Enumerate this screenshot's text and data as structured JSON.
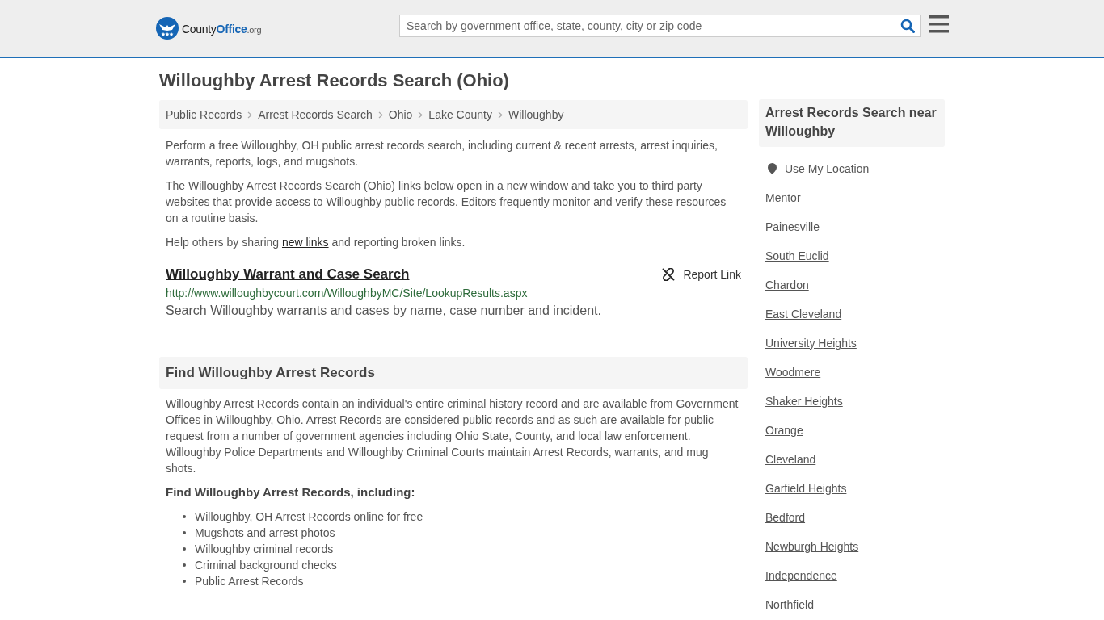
{
  "header": {
    "logo": {
      "parts": [
        "County",
        "Office",
        ".org"
      ]
    },
    "search": {
      "placeholder": "Search by government office, state, county, city or zip code"
    }
  },
  "page_title": "Willoughby Arrest Records Search (Ohio)",
  "breadcrumb": [
    "Public Records",
    "Arrest Records Search",
    "Ohio",
    "Lake County",
    "Willoughby"
  ],
  "intro": [
    "Perform a free Willoughby, OH public arrest records search, including current & recent arrests, arrest inquiries, warrants, reports, logs, and mugshots.",
    "The Willoughby Arrest Records Search (Ohio) links below open in a new window and take you to third party websites that provide access to Willoughby public records. Editors frequently monitor and verify these resources on a routine basis."
  ],
  "help": {
    "before": "Help others by sharing ",
    "link": "new links",
    "after": " and reporting broken links."
  },
  "links": [
    {
      "title": "Willoughby Warrant and Case Search",
      "report": "Report Link",
      "url": "http://www.willoughbycourt.com/WilloughbyMC/Site/LookupResults.aspx",
      "description": "Search Willoughby warrants and cases by name, case number and incident."
    }
  ],
  "section": {
    "heading": "Find Willoughby Arrest Records",
    "paragraph": "Willoughby Arrest Records contain an individual's entire criminal history record and are available from Government Offices in Willoughby, Ohio. Arrest Records are considered public records and as such are available for public request from a number of government agencies including Ohio State, County, and local law enforcement. Willoughby Police Departments and Willoughby Criminal Courts maintain Arrest Records, warrants, and mug shots.",
    "subheading": "Find Willoughby Arrest Records, including:",
    "items": [
      "Willoughby, OH Arrest Records online for free",
      "Mugshots and arrest photos",
      "Willoughby criminal records",
      "Criminal background checks",
      "Public Arrest Records"
    ]
  },
  "sidebar": {
    "heading": "Arrest Records Search near Willoughby",
    "location": "Use My Location",
    "places": [
      "Mentor",
      "Painesville",
      "South Euclid",
      "Chardon",
      "East Cleveland",
      "University Heights",
      "Woodmere",
      "Shaker Heights",
      "Orange",
      "Cleveland",
      "Garfield Heights",
      "Bedford",
      "Newburgh Heights",
      "Independence",
      "Northfield"
    ]
  }
}
